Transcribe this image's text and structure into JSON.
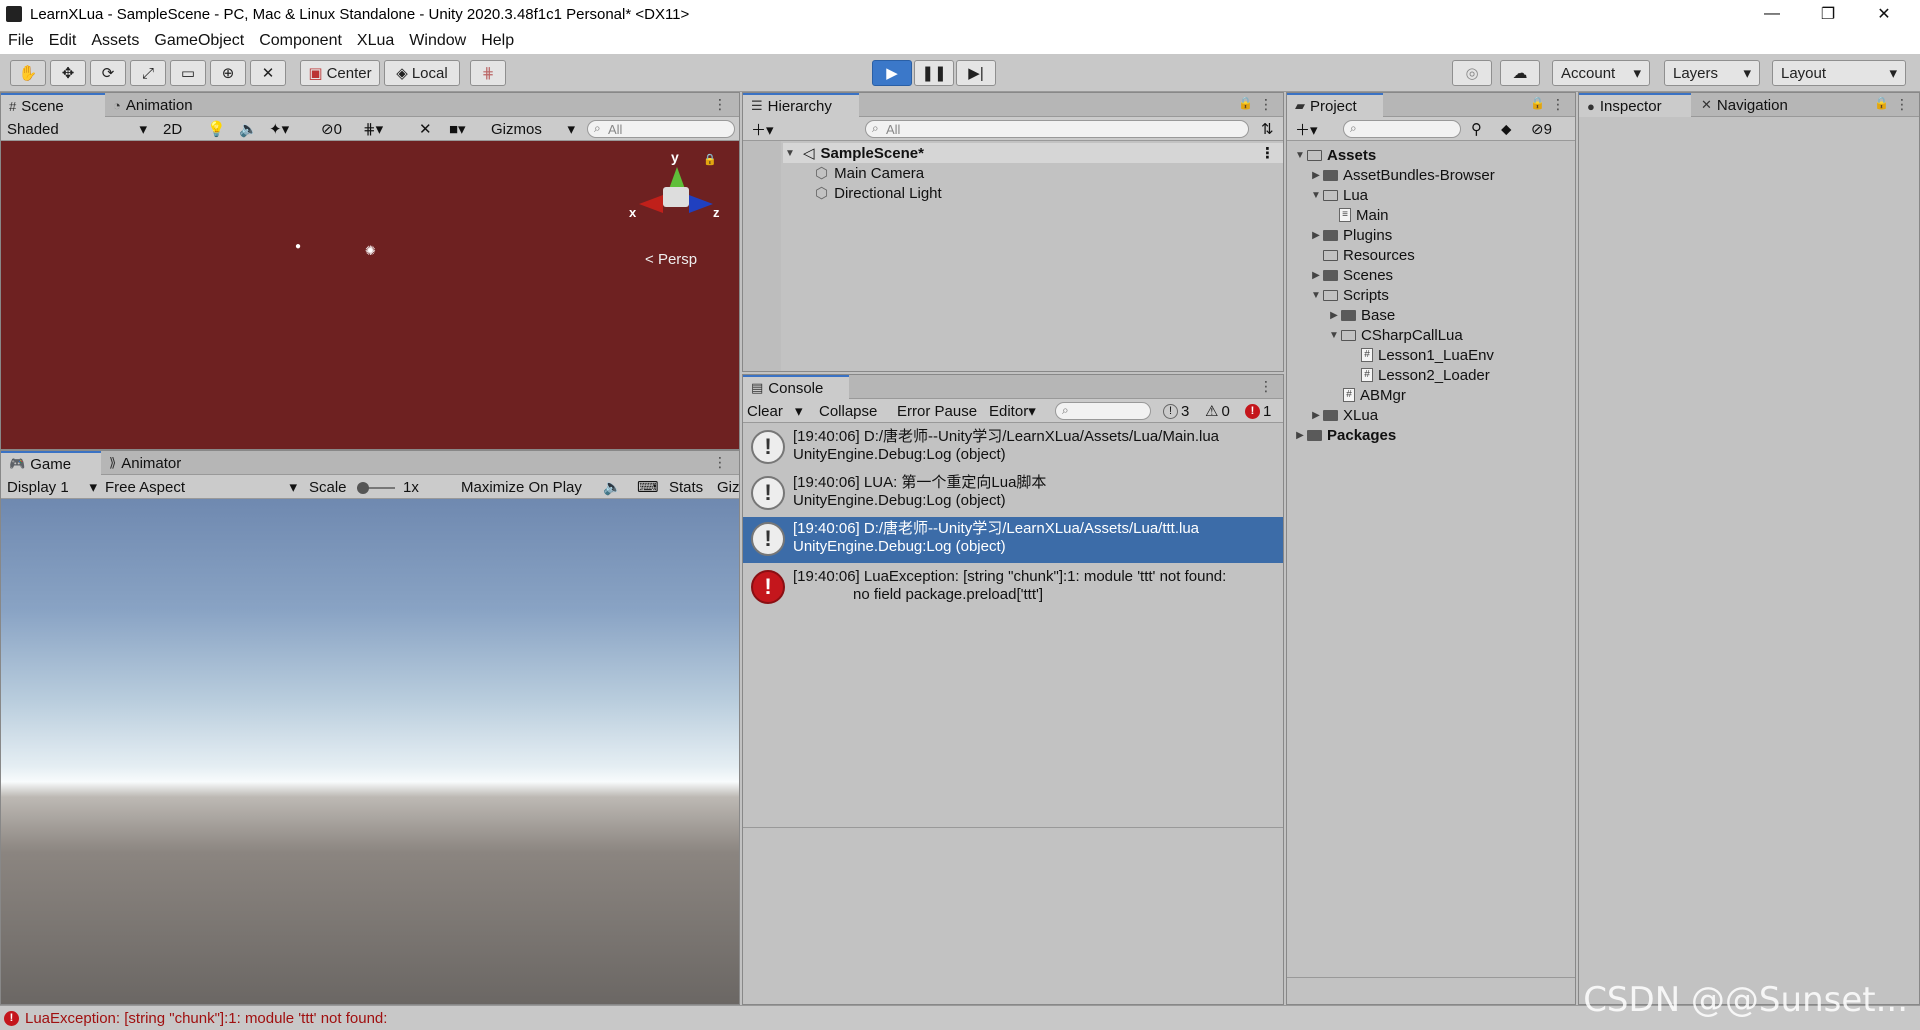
{
  "window": {
    "title": "LearnXLua - SampleScene - PC, Mac & Linux Standalone - Unity 2020.3.48f1c1 Personal* <DX11>",
    "minimize": "—",
    "restore": "❐",
    "close": "✕"
  },
  "menu": [
    "File",
    "Edit",
    "Assets",
    "GameObject",
    "Component",
    "XLua",
    "Window",
    "Help"
  ],
  "toolbar": {
    "center_label": "Center",
    "local_label": "Local",
    "account_label": "Account",
    "layers_label": "Layers",
    "layout_label": "Layout"
  },
  "scene_panel": {
    "tabs": [
      "Scene",
      "Animation"
    ],
    "shading": "Shaded",
    "mode_2d": "2D",
    "hidden_count": "0",
    "gizmos_label": "Gizmos",
    "search_placeholder": "All",
    "axis_y": "y",
    "axis_x": "x",
    "axis_z": "z",
    "persp_label": "Persp"
  },
  "game_panel": {
    "tabs": [
      "Game",
      "Animator"
    ],
    "display": "Display 1",
    "aspect": "Free Aspect",
    "scale_label": "Scale",
    "scale_value": "1x",
    "maximize_label": "Maximize On Play",
    "stats_label": "Stats",
    "gizmos_label": "Giz"
  },
  "hierarchy": {
    "tab": "Hierarchy",
    "search_placeholder": "All",
    "scene_name": "SampleScene*",
    "items": [
      "Main Camera",
      "Directional Light"
    ]
  },
  "console": {
    "tab": "Console",
    "clear": "Clear",
    "collapse": "Collapse",
    "error_pause": "Error Pause",
    "editor": "Editor",
    "count_log": "3",
    "count_warn": "0",
    "count_err": "1",
    "entries": [
      {
        "line1": "[19:40:06] D:/唐老师--Unity学习/LearnXLua/Assets/Lua/Main.lua",
        "line2": "UnityEngine.Debug:Log (object)"
      },
      {
        "line1": "[19:40:06] LUA: 第一个重定向Lua脚本",
        "line2": "UnityEngine.Debug:Log (object)"
      },
      {
        "line1": "[19:40:06] D:/唐老师--Unity学习/LearnXLua/Assets/Lua/ttt.lua",
        "line2": "UnityEngine.Debug:Log (object)"
      },
      {
        "line1": "[19:40:06] LuaException: [string \"chunk\"]:1: module 'ttt' not found:",
        "line2": "no field package.preload['ttt']"
      }
    ]
  },
  "project": {
    "tab": "Project",
    "hidden_count": "9",
    "tree": {
      "assets": "Assets",
      "assetbundles": "AssetBundles-Browser",
      "lua": "Lua",
      "main": "Main",
      "plugins": "Plugins",
      "resources": "Resources",
      "scenes": "Scenes",
      "scripts": "Scripts",
      "base": "Base",
      "csharpcalllua": "CSharpCallLua",
      "lesson1": "Lesson1_LuaEnv",
      "lesson2": "Lesson2_Loader",
      "abmgr": "ABMgr",
      "xlua": "XLua",
      "packages": "Packages"
    }
  },
  "inspector": {
    "tabs": [
      "Inspector",
      "Navigation"
    ]
  },
  "status": {
    "message": "LuaException: [string \"chunk\"]:1: module 'ttt' not found:"
  },
  "watermark": "CSDN @@Sunset..."
}
